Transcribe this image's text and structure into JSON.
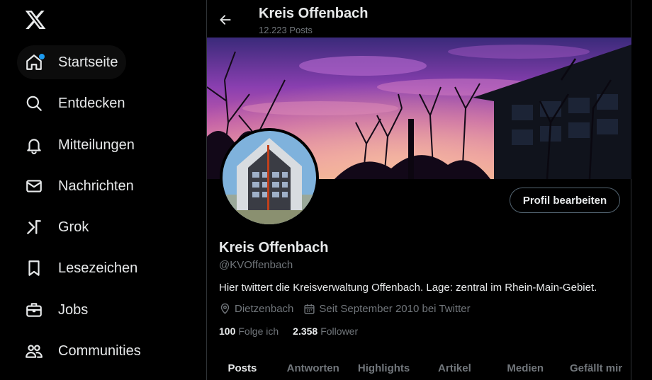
{
  "sidebar": {
    "logo_icon": "x-logo-icon",
    "items": [
      {
        "label": "Startseite",
        "icon": "home-icon"
      },
      {
        "label": "Entdecken",
        "icon": "search-icon"
      },
      {
        "label": "Mitteilungen",
        "icon": "bell-icon"
      },
      {
        "label": "Nachrichten",
        "icon": "envelope-icon"
      },
      {
        "label": "Grok",
        "icon": "grok-icon"
      },
      {
        "label": "Lesezeichen",
        "icon": "bookmark-icon"
      },
      {
        "label": "Jobs",
        "icon": "briefcase-icon"
      },
      {
        "label": "Communities",
        "icon": "people-icon"
      }
    ]
  },
  "header": {
    "title": "Kreis Offenbach",
    "post_count": "12.223 Posts"
  },
  "profile": {
    "edit_button": "Profil bearbeiten",
    "name": "Kreis Offenbach",
    "handle": "@KVOffenbach",
    "bio": "Hier twittert die Kreisverwaltung Offenbach. Lage: zentral im Rhein-Main-Gebiet.",
    "location": "Dietzenbach",
    "joined": "Seit September 2010 bei Twitter",
    "following_count": "100",
    "following_label": "Folge ich",
    "followers_count": "2.358",
    "followers_label": "Follower"
  },
  "tabs": [
    "Posts",
    "Antworten",
    "Highlights",
    "Artikel",
    "Medien",
    "Gefällt mir"
  ],
  "colors": {
    "accent": "#1d9bf0",
    "background": "#000000",
    "text_primary": "#e7e9ea",
    "text_secondary": "#71767b",
    "border": "#2f3336"
  }
}
